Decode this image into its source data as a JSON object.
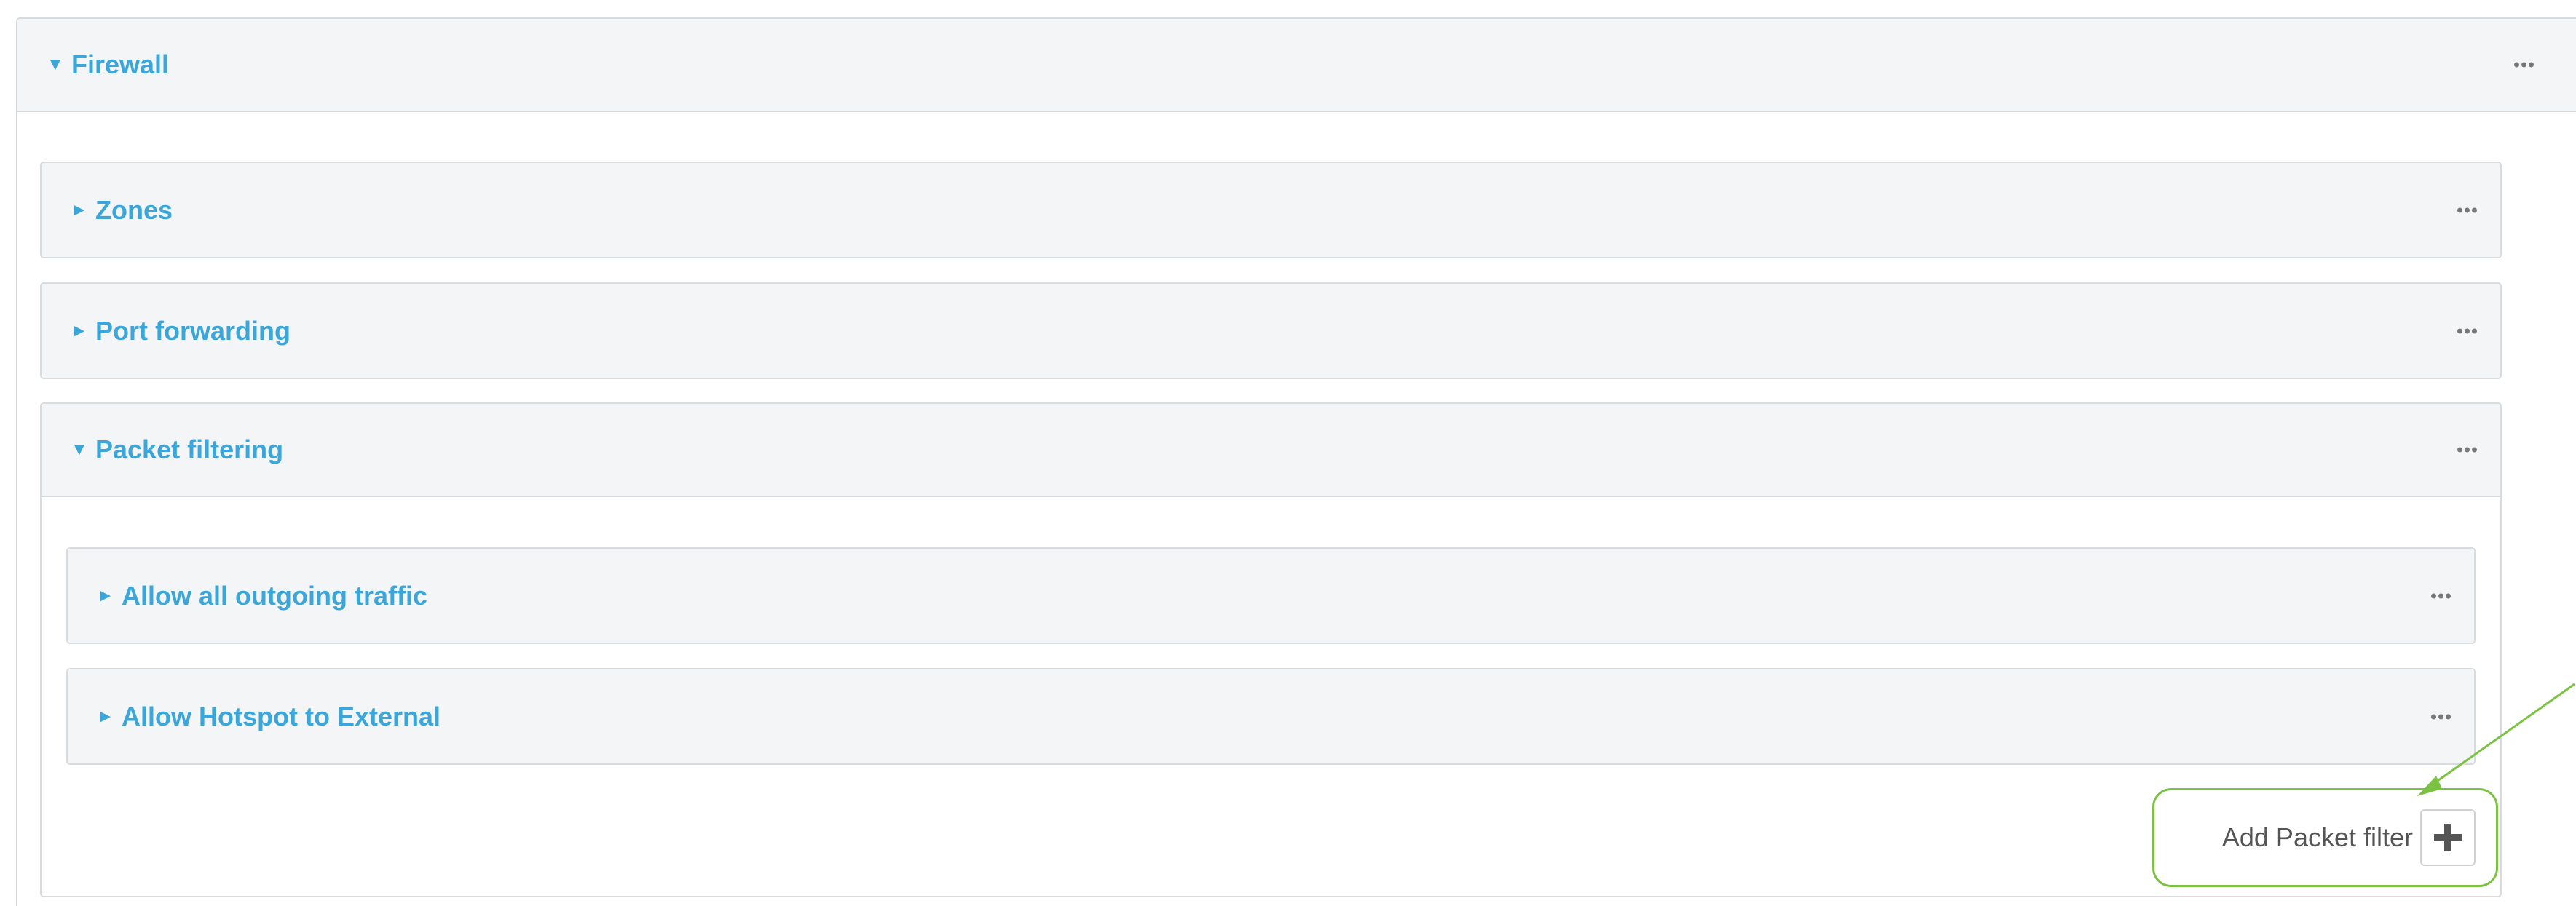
{
  "firewall": {
    "title": "Firewall",
    "expanded": true,
    "sections": {
      "zones": {
        "title": "Zones",
        "expanded": false
      },
      "port_forwarding": {
        "title": "Port forwarding",
        "expanded": false
      },
      "packet_filtering": {
        "title": "Packet filtering",
        "expanded": true,
        "rules": [
          {
            "title": "Allow all outgoing traffic",
            "expanded": false
          },
          {
            "title": "Allow Hotspot to External",
            "expanded": false
          }
        ],
        "add_label": "Add Packet filter"
      }
    }
  },
  "icons": {
    "expanded_arrow": "▼",
    "collapsed_arrow": "►",
    "menu": "more-dots-icon",
    "add": "plus-icon"
  },
  "colors": {
    "link_blue": "#3aa6d9",
    "header_bg": "#f4f5f6",
    "border": "#d9dcdf",
    "callout_green": "#7cc242"
  }
}
